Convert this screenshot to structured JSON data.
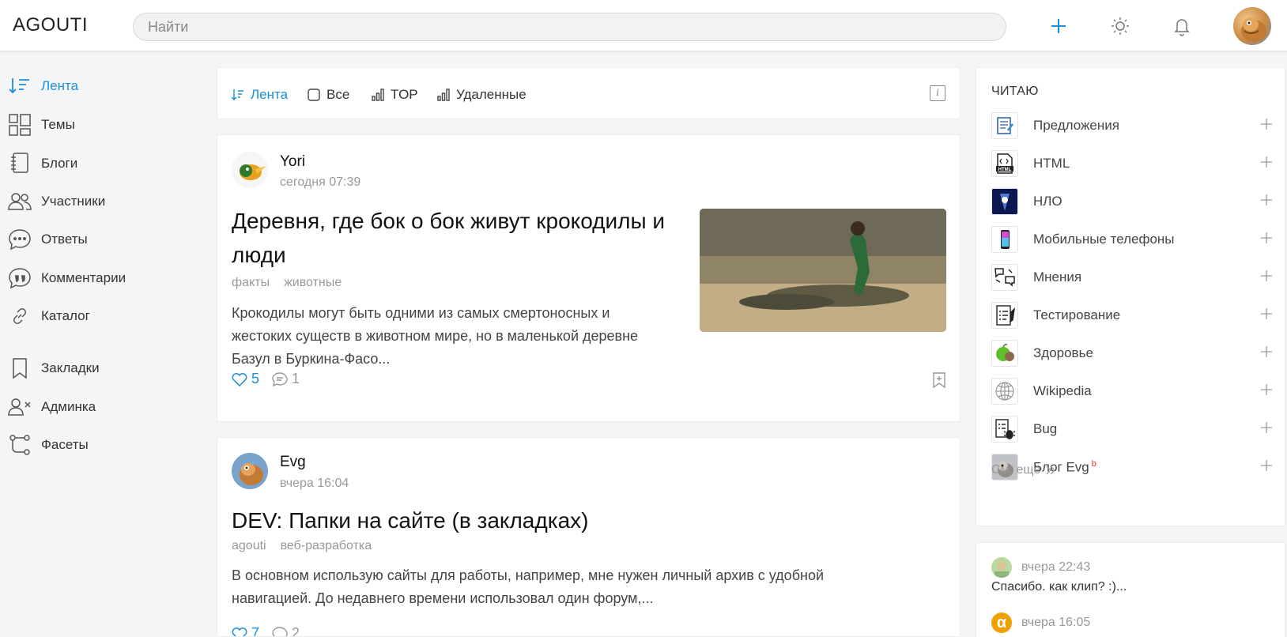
{
  "header": {
    "logo": "AGOUTI",
    "search_placeholder": "Найти"
  },
  "icons": {
    "add": "plus-icon",
    "theme": "sun-icon",
    "notifications": "bell-icon"
  },
  "colors": {
    "accent": "#1a8fd9",
    "muted": "#999999",
    "new_badge": "#e33333"
  },
  "sidebar": {
    "items": [
      {
        "label": "Лента",
        "icon": "feed-sort-icon",
        "active": true
      },
      {
        "label": "Темы",
        "icon": "topics-grid-icon"
      },
      {
        "label": "Блоги",
        "icon": "notebook-icon"
      },
      {
        "label": "Участники",
        "icon": "users-icon"
      },
      {
        "label": "Ответы",
        "icon": "chat-dots-icon"
      },
      {
        "label": "Комментарии",
        "icon": "quote-bubble-icon"
      },
      {
        "label": "Каталог",
        "icon": "link-icon"
      },
      {
        "label": "Закладки",
        "icon": "bookmark-icon"
      },
      {
        "label": "Админка",
        "icon": "user-x-icon"
      },
      {
        "label": "Фасеты",
        "icon": "facets-icon"
      }
    ]
  },
  "feed_tabs": {
    "items": [
      {
        "label": "Лента",
        "icon": "sort-icon",
        "active": true
      },
      {
        "label": "Все",
        "icon": "checkbox-icon"
      },
      {
        "label": "TOP",
        "icon": "bars-icon"
      },
      {
        "label": "Удаленные",
        "icon": "bars-icon"
      }
    ],
    "info_label": "i"
  },
  "posts": [
    {
      "author": "Yori",
      "date": "сегодня 07:39",
      "title_lines": [
        "Деревня, где бок о бок живут крокодилы и",
        "люди"
      ],
      "tags": [
        "факты",
        "животные"
      ],
      "excerpt_lines": [
        "Крокодилы могут быть одними из самых смертоносных и",
        "жестоких существ в животном мире, но в маленькой деревне",
        "Базул в Буркина-Фасо..."
      ],
      "likes": "5",
      "comments": "1"
    },
    {
      "author": "Evg",
      "date": "вчера 16:04",
      "title": "DEV: Папки на сайте (в закладках)",
      "tags": [
        "agouti",
        "веб-разработка"
      ],
      "excerpt_lines": [
        "В основном использую сайты для работы, например, мне нужен личный архив с удобной",
        "навигацией. До недавнего времени использовал один форум,..."
      ],
      "likes": "7",
      "comments": "2"
    }
  ],
  "reading": {
    "heading": "ЧИТАЮ",
    "topics": [
      {
        "name": "Предложения",
        "icon": "notepad-icon"
      },
      {
        "name": "HTML",
        "icon": "html-file-icon"
      },
      {
        "name": "НЛО",
        "icon": "ufo-icon"
      },
      {
        "name": "Мобильные телефоны",
        "icon": "phone-icon"
      },
      {
        "name": "Мнения",
        "icon": "opinions-icon"
      },
      {
        "name": "Тестирование",
        "icon": "test-checklist-icon"
      },
      {
        "name": "Здоровье",
        "icon": "apple-icon"
      },
      {
        "name": "Wikipedia",
        "icon": "wikipedia-globe-icon"
      },
      {
        "name": "Bug",
        "icon": "bug-icon"
      },
      {
        "name": "Блог Evg",
        "icon": "squirrel-icon",
        "badge": "b"
      }
    ],
    "more_label": "См. ещё"
  },
  "recent_comments": [
    {
      "date": "вчера 22:43",
      "text": "Спасибо. как клип? :)..."
    },
    {
      "date": "вчера 16:05",
      "avatar_letter": "α"
    }
  ]
}
